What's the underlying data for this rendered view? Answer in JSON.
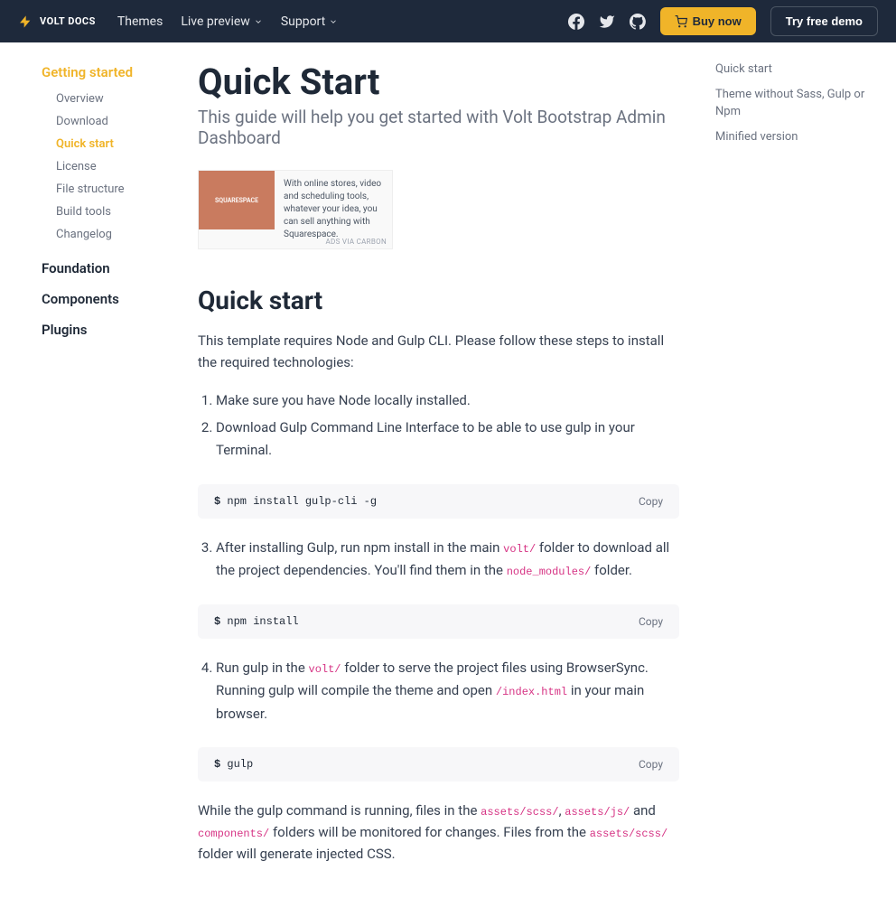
{
  "navbar": {
    "logo_text": "VOLT DOCS",
    "themes": "Themes",
    "live_preview": "Live preview",
    "support": "Support",
    "buy_now": "Buy now",
    "try_demo": "Try free demo"
  },
  "sidebar": {
    "getting_started": "Getting started",
    "items": {
      "overview": "Overview",
      "download": "Download",
      "quick_start": "Quick start",
      "license": "License",
      "file_structure": "File structure",
      "build_tools": "Build tools",
      "changelog": "Changelog"
    },
    "foundation": "Foundation",
    "components": "Components",
    "plugins": "Plugins"
  },
  "toc": {
    "quick_start": "Quick start",
    "theme_without": "Theme without Sass, Gulp or Npm",
    "minified": "Minified version"
  },
  "page": {
    "title": "Quick Start",
    "subtitle": "This guide will help you get started with Volt Bootstrap Admin Dashboard"
  },
  "ad": {
    "brand": "SQUARESPACE",
    "text": "With online stores, video and scheduling tools, whatever your idea, you can sell anything with Squarespace.",
    "credit": "ADS VIA CARBON"
  },
  "content": {
    "section_title": "Quick start",
    "intro": "This template requires Node and Gulp CLI. Please follow these steps to install the required technologies:",
    "step1": "Make sure you have Node locally installed.",
    "step2": "Download Gulp Command Line Interface to be able to use gulp in your Terminal.",
    "code1_prompt": "$",
    "code1": "npm install gulp-cli -g",
    "copy": "Copy",
    "step3_pre": "After installing Gulp, run npm install in the main ",
    "step3_code1": "volt/",
    "step3_mid": " folder to download all the project dependencies. You'll find them in the ",
    "step3_code2": "node_modules/",
    "step3_post": " folder.",
    "code2": "npm install",
    "step4_pre": "Run gulp in the ",
    "step4_code1": "volt/",
    "step4_mid": " folder to serve the project files using BrowserSync. Running gulp will compile the theme and open ",
    "step4_code2": "/index.html",
    "step4_post": " in your main browser.",
    "code3": "gulp",
    "footer_pre": "While the gulp command is running, files in the ",
    "footer_c1": "assets/scss/",
    "footer_m1": ", ",
    "footer_c2": "assets/js/",
    "footer_m2": " and ",
    "footer_c3": "components/",
    "footer_m3": " folders will be monitored for changes. Files from the ",
    "footer_c4": "assets/scss/",
    "footer_post": " folder will generate injected CSS."
  }
}
